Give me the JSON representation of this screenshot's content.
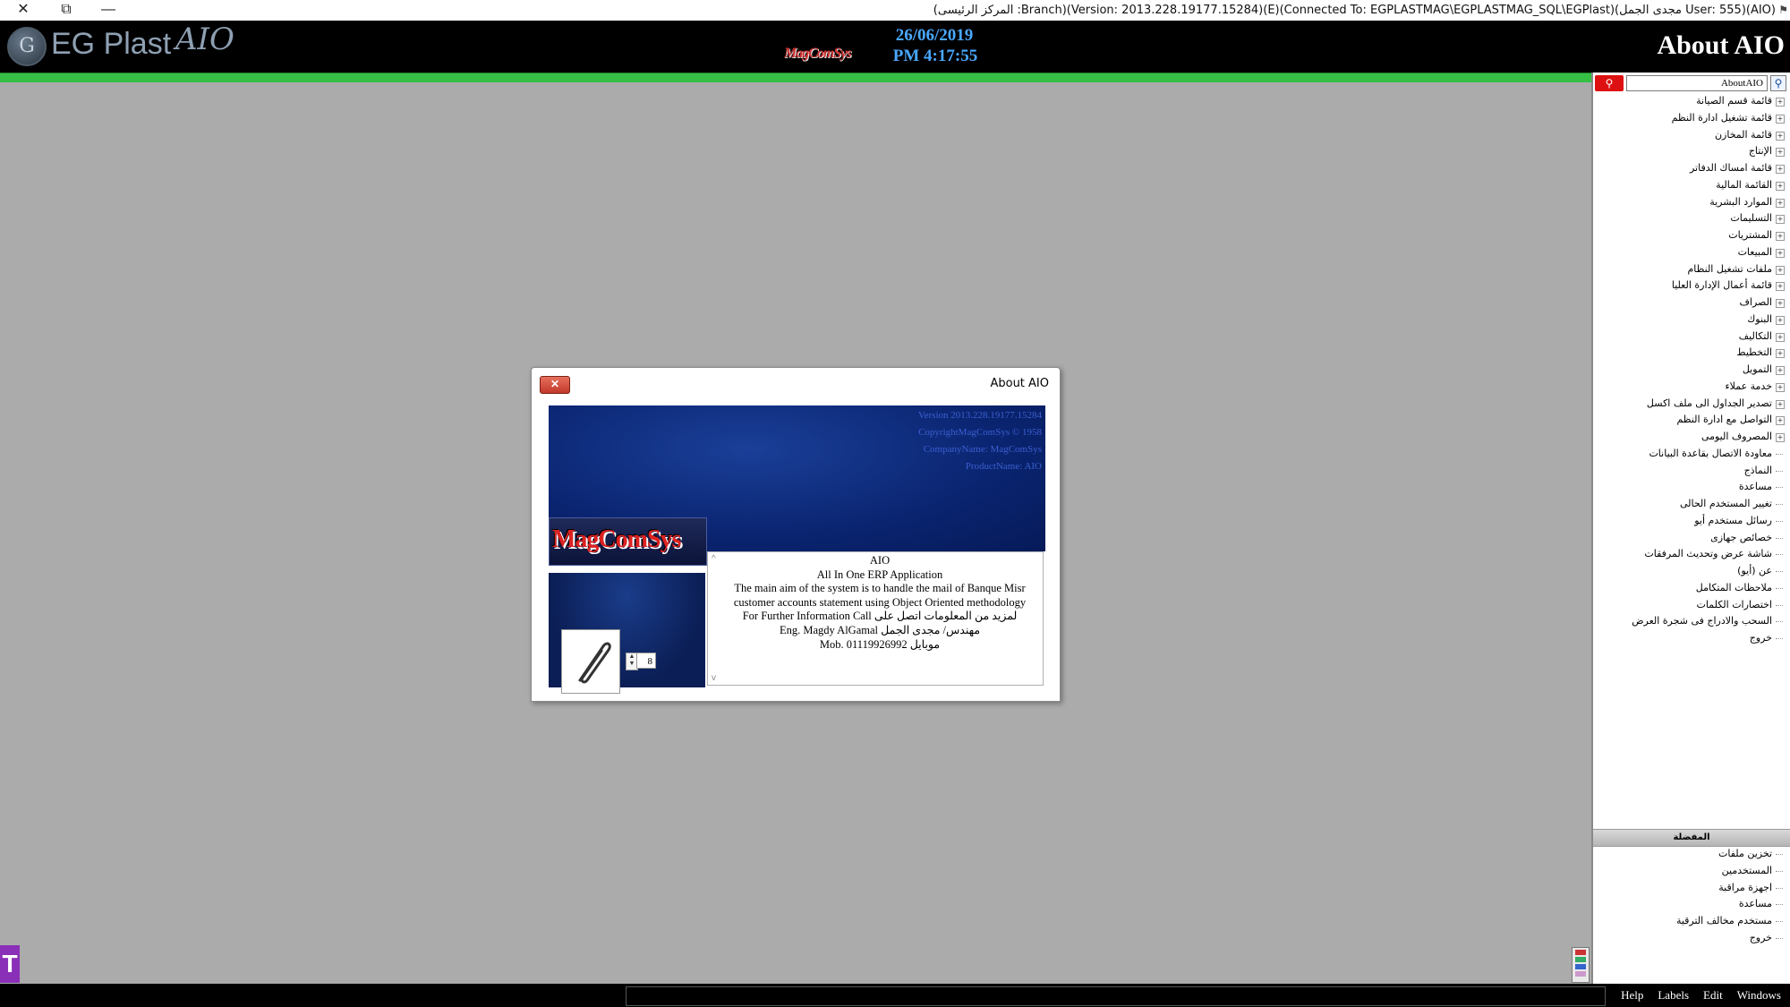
{
  "window": {
    "title": "(المركز الرئيسى :Branch)(Version: 2013.228.19177.15284)(E)(Connected To: EGPLASTMAG\\EGPLASTMAG_SQL\\EGPlast)(مجدى الجمل User: 555)(AIO)",
    "close_glyph": "✕",
    "restore_glyph": "⧉",
    "minimize_glyph": "—"
  },
  "header": {
    "logo_text": "EG Plast",
    "logo_script": "AIO",
    "brand_small": "MagComSys",
    "date": "26/06/2019",
    "time": "PM 4:17:55",
    "page_title": "About AIO"
  },
  "search": {
    "value": "AboutAIO",
    "button_icon": "search-icon",
    "go_icon": "magnifier-icon"
  },
  "tree": {
    "items": [
      {
        "label": "قائمة قسم الصيانة",
        "expandable": true
      },
      {
        "label": "قائمة تشغيل ادارة النظم",
        "expandable": true
      },
      {
        "label": "قائمة المخازن",
        "expandable": true
      },
      {
        "label": "الإنتاج",
        "expandable": true
      },
      {
        "label": "قائمة امساك الدفاتر",
        "expandable": true
      },
      {
        "label": "القائمة المالية",
        "expandable": true
      },
      {
        "label": "الموارد البشرية",
        "expandable": true
      },
      {
        "label": "التسليمات",
        "expandable": true
      },
      {
        "label": "المشتريات",
        "expandable": true
      },
      {
        "label": "المبيعات",
        "expandable": true
      },
      {
        "label": "ملفات تشغيل النظام",
        "expandable": true
      },
      {
        "label": "قائمة أعمال الإدارة العليا",
        "expandable": true
      },
      {
        "label": "الصراف",
        "expandable": true
      },
      {
        "label": "البنوك",
        "expandable": true
      },
      {
        "label": "التكاليف",
        "expandable": true
      },
      {
        "label": "التخطيط",
        "expandable": true
      },
      {
        "label": "التمويل",
        "expandable": true
      },
      {
        "label": "خدمة عملاء",
        "expandable": true
      },
      {
        "label": "تصدير الجداول الى ملف اكسل",
        "expandable": true
      },
      {
        "label": "التواصل مع ادارة النظم",
        "expandable": true
      },
      {
        "label": "المصروف اليومى",
        "expandable": true
      },
      {
        "label": "معاودة الاتصال بقاعدة البيانات",
        "expandable": false
      },
      {
        "label": "النماذج",
        "expandable": false
      },
      {
        "label": "مساعدة",
        "expandable": false
      },
      {
        "label": "تغيير المستخدم الحالى",
        "expandable": false
      },
      {
        "label": "رسائل مستخدم أيو",
        "expandable": false
      },
      {
        "label": "خصائص جهازى",
        "expandable": false
      },
      {
        "label": "شاشة عرض وتحديث المرفقات",
        "expandable": false
      },
      {
        "label": "عن (أيو)",
        "expandable": false
      },
      {
        "label": "ملاحظات المتكامل",
        "expandable": false
      },
      {
        "label": "اختصارات الكلمات",
        "expandable": false
      },
      {
        "label": "السحب والادراج فى شجرة العرض",
        "expandable": false
      },
      {
        "label": "خروج",
        "expandable": false
      }
    ]
  },
  "favorites": {
    "header": "المفضلة",
    "items": [
      "تخزين ملفات",
      "المستخدمين",
      "اجهزة مراقبة",
      "مساعدة",
      "مستخدم مخالف الترقية",
      "خروج"
    ]
  },
  "dialog": {
    "title": "About AIO",
    "close_glyph": "✕",
    "info_lines": [
      "Version 2013.228.19177.15284",
      "CopyrightMagComSys © 1958",
      "CompanyName: MagComSys",
      "ProductName: AIO"
    ],
    "logo_text": "MagComSys",
    "spinner_value": "8",
    "about_lines": [
      "AIO",
      "All In One ERP Application",
      "The main aim of the system is to handle the mail of Banque Misr",
      "customer accounts statement using Object Oriented methodology",
      "For Further Information Call لمزيد من المعلومات اتصل على",
      "Eng. Magdy AlGamal  مهندس/ مجدى الجمل",
      "Mob. 01119926992 موبايل"
    ]
  },
  "statusbar": {
    "menu": [
      "Windows",
      "Edit",
      "Labels",
      "Help"
    ]
  },
  "colors": {
    "header_bg": "#000000",
    "accent_green": "#35c045",
    "workspace_bg": "#ababab",
    "clock_blue": "#4aa8ff",
    "dialog_blue": "#0a2470",
    "search_red": "#dd1111"
  }
}
